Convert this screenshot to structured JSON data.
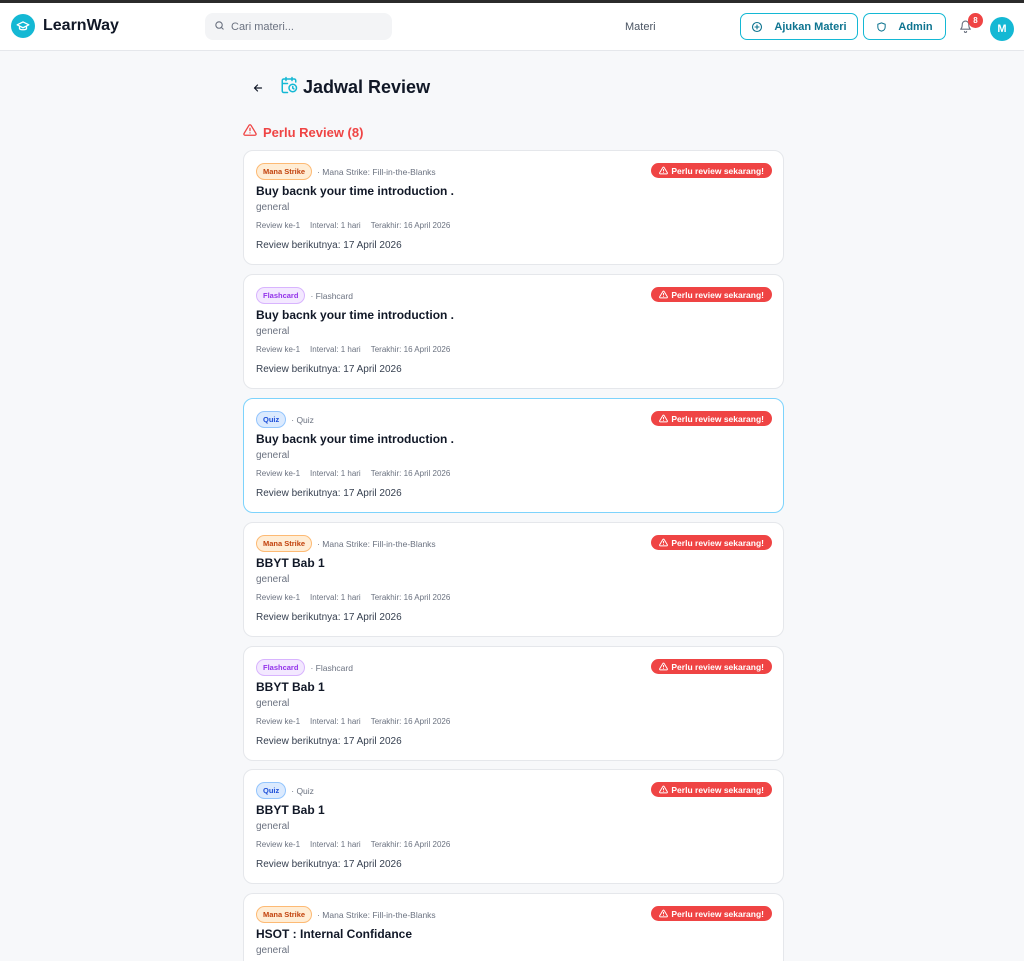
{
  "app": {
    "name": "LearnWay"
  },
  "search": {
    "placeholder": "Cari materi..."
  },
  "nav": {
    "materi": "Materi",
    "ajukan": "Ajukan Materi",
    "admin": "Admin",
    "notif_count": "8",
    "avatar": "M"
  },
  "page": {
    "title": "Jadwal Review",
    "section_title": "Perlu Review (8)"
  },
  "colors": {
    "accent": "#14b8d4",
    "danger": "#ef4444"
  },
  "cards": [
    {
      "tag": "Mana Strike",
      "subtitle": "· Mana Strike: Fill-in-the-Blanks",
      "title": "Buy bacnk your time introduction .",
      "category": "general",
      "review": "Review ke-1",
      "interval": "Interval: 1 hari",
      "last": "Terakhir: 16 April 2026",
      "next": "Review berikutnya: 17 April 2026",
      "status": "Perlu review sekarang!"
    },
    {
      "tag": "Flashcard",
      "subtitle": "· Flashcard",
      "title": "Buy bacnk your time introduction .",
      "category": "general",
      "review": "Review ke-1",
      "interval": "Interval: 1 hari",
      "last": "Terakhir: 16 April 2026",
      "next": "Review berikutnya: 17 April 2026",
      "status": "Perlu review sekarang!"
    },
    {
      "tag": "Quiz",
      "subtitle": "· Quiz",
      "title": "Buy bacnk your time introduction .",
      "category": "general",
      "review": "Review ke-1",
      "interval": "Interval: 1 hari",
      "last": "Terakhir: 16 April 2026",
      "next": "Review berikutnya: 17 April 2026",
      "status": "Perlu review sekarang!"
    },
    {
      "tag": "Mana Strike",
      "subtitle": "· Mana Strike: Fill-in-the-Blanks",
      "title": "BBYT Bab 1",
      "category": "general",
      "review": "Review ke-1",
      "interval": "Interval: 1 hari",
      "last": "Terakhir: 16 April 2026",
      "next": "Review berikutnya: 17 April 2026",
      "status": "Perlu review sekarang!"
    },
    {
      "tag": "Flashcard",
      "subtitle": "· Flashcard",
      "title": "BBYT Bab 1",
      "category": "general",
      "review": "Review ke-1",
      "interval": "Interval: 1 hari",
      "last": "Terakhir: 16 April 2026",
      "next": "Review berikutnya: 17 April 2026",
      "status": "Perlu review sekarang!"
    },
    {
      "tag": "Quiz",
      "subtitle": "· Quiz",
      "title": "BBYT Bab 1",
      "category": "general",
      "review": "Review ke-1",
      "interval": "Interval: 1 hari",
      "last": "Terakhir: 16 April 2026",
      "next": "Review berikutnya: 17 April 2026",
      "status": "Perlu review sekarang!"
    },
    {
      "tag": "Mana Strike",
      "subtitle": "· Mana Strike: Fill-in-the-Blanks",
      "title": "HSOT : Internal Confidance",
      "category": "general",
      "status": "Perlu review sekarang!"
    }
  ]
}
